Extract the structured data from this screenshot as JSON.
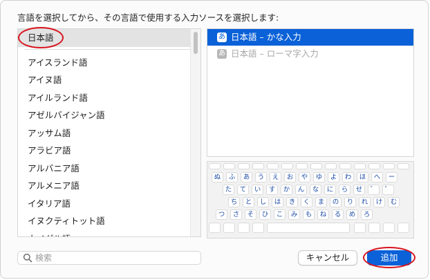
{
  "instruction": "言語を選択してから、その言語で使用する入力ソースを選択します:",
  "languages": {
    "pinned": "日本語",
    "items": [
      "アイスランド語",
      "アイヌ語",
      "アイルランド語",
      "アゼルバイジャン語",
      "アッサム語",
      "アラビア語",
      "アルバニア語",
      "アルメニア語",
      "イタリア語",
      "イヌクティトット語",
      "ウイグル語"
    ]
  },
  "input_sources": [
    {
      "badge": "あ",
      "label": "日本語 – かな入力",
      "state": "selected"
    },
    {
      "badge": "あ",
      "label": "日本語 – ローマ字入力",
      "state": "disabled"
    }
  ],
  "keyboard": {
    "rows": [
      [
        "ぬ",
        "ふ",
        "あ",
        "う",
        "え",
        "お",
        "や",
        "ゆ",
        "よ",
        "わ",
        "ほ",
        "へ",
        "ー"
      ],
      [
        "た",
        "て",
        "い",
        "す",
        "か",
        "ん",
        "な",
        "に",
        "ら",
        "せ",
        "゛",
        "゜"
      ],
      [
        "ち",
        "と",
        "し",
        "は",
        "き",
        "く",
        "ま",
        "の",
        "り",
        "れ",
        "け",
        "む"
      ],
      [
        "つ",
        "さ",
        "そ",
        "ひ",
        "こ",
        "み",
        "も",
        "ね",
        "る",
        "め",
        "ろ"
      ]
    ]
  },
  "search": {
    "placeholder": "検索",
    "value": ""
  },
  "buttons": {
    "cancel": "キャンセル",
    "add": "追加"
  },
  "colors": {
    "accent": "#0a61d8",
    "annotation": "#d8141e"
  }
}
